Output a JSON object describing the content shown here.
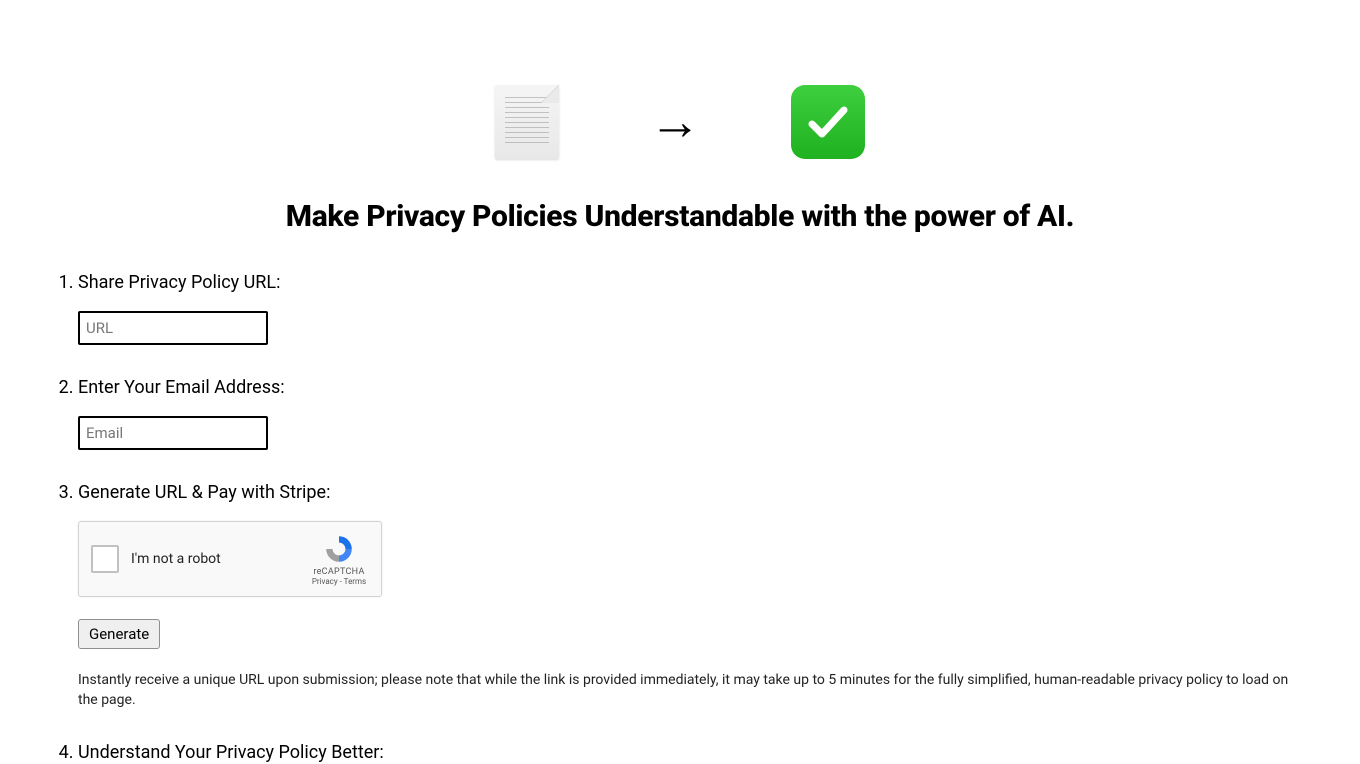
{
  "hero": {
    "doc_icon_name": "document-icon",
    "arrow_icon_name": "arrow-right-icon",
    "check_icon_name": "checkmark-icon"
  },
  "headline": "Make Privacy Policies Understandable with the power of AI.",
  "steps": [
    {
      "label": "Share Privacy Policy URL:",
      "input_placeholder": "URL"
    },
    {
      "label": "Enter Your Email Address:",
      "input_placeholder": "Email"
    },
    {
      "label": "Generate URL & Pay with Stripe:",
      "recaptcha": {
        "checkbox_label": "I'm not a robot",
        "brand": "reCAPTCHA",
        "links": "Privacy - Terms"
      },
      "button_label": "Generate",
      "note": "Instantly receive a unique URL upon submission; please note that while the link is provided immediately, it may take up to 5 minutes for the fully simplified, human-readable privacy policy to load on the page."
    },
    {
      "label": "Understand Your Privacy Policy Better:"
    }
  ]
}
